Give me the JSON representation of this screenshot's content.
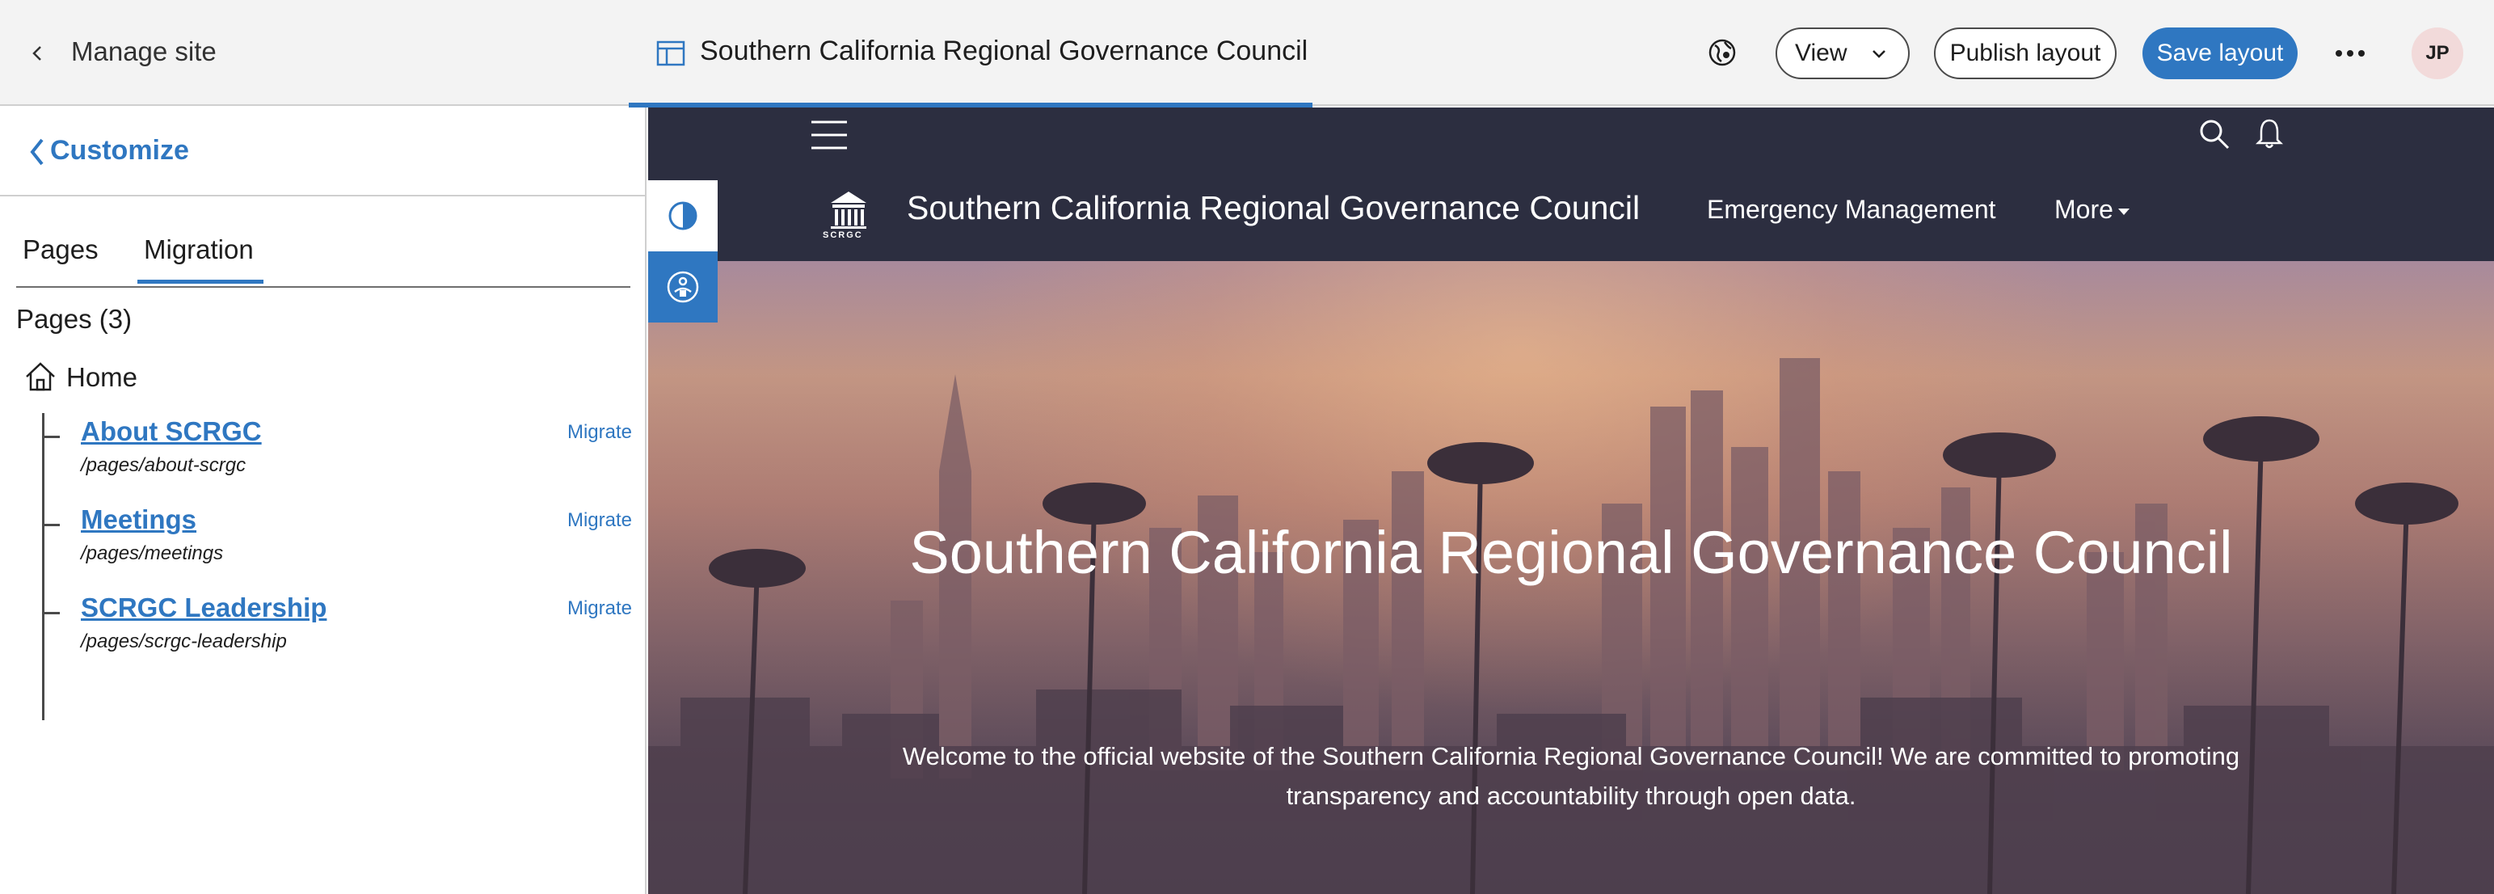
{
  "topbar": {
    "manage_site": "Manage site",
    "site_title": "Southern California Regional Governance Council",
    "view_label": "View",
    "publish_label": "Publish layout",
    "save_label": "Save layout",
    "avatar_initials": "JP",
    "accent_color": "#2f77c1"
  },
  "leftpanel": {
    "customize_label": "Customize",
    "tabs": [
      {
        "label": "Pages",
        "active": false
      },
      {
        "label": "Migration",
        "active": true
      }
    ],
    "pages_count": "Pages (3)",
    "home_label": "Home",
    "pages": [
      {
        "title": "About SCRGC",
        "path": "/pages/about-scrgc",
        "action": "Migrate"
      },
      {
        "title": "Meetings",
        "path": "/pages/meetings",
        "action": "Migrate"
      },
      {
        "title": "SCRGC Leadership",
        "path": "/pages/scrgc-leadership",
        "action": "Migrate"
      }
    ]
  },
  "preview": {
    "logo_text": "SCRGC",
    "brand_name": "Southern California Regional Governance Council",
    "nav": [
      {
        "label": "Emergency Management"
      },
      {
        "label": "More"
      }
    ],
    "hero_title": "Southern California Regional Governance Council",
    "hero_text": "Welcome to the official website of the Southern California Regional Governance Council! We are committed to promoting transparency and accountability through open data.",
    "header_color": "#2c2e40"
  }
}
